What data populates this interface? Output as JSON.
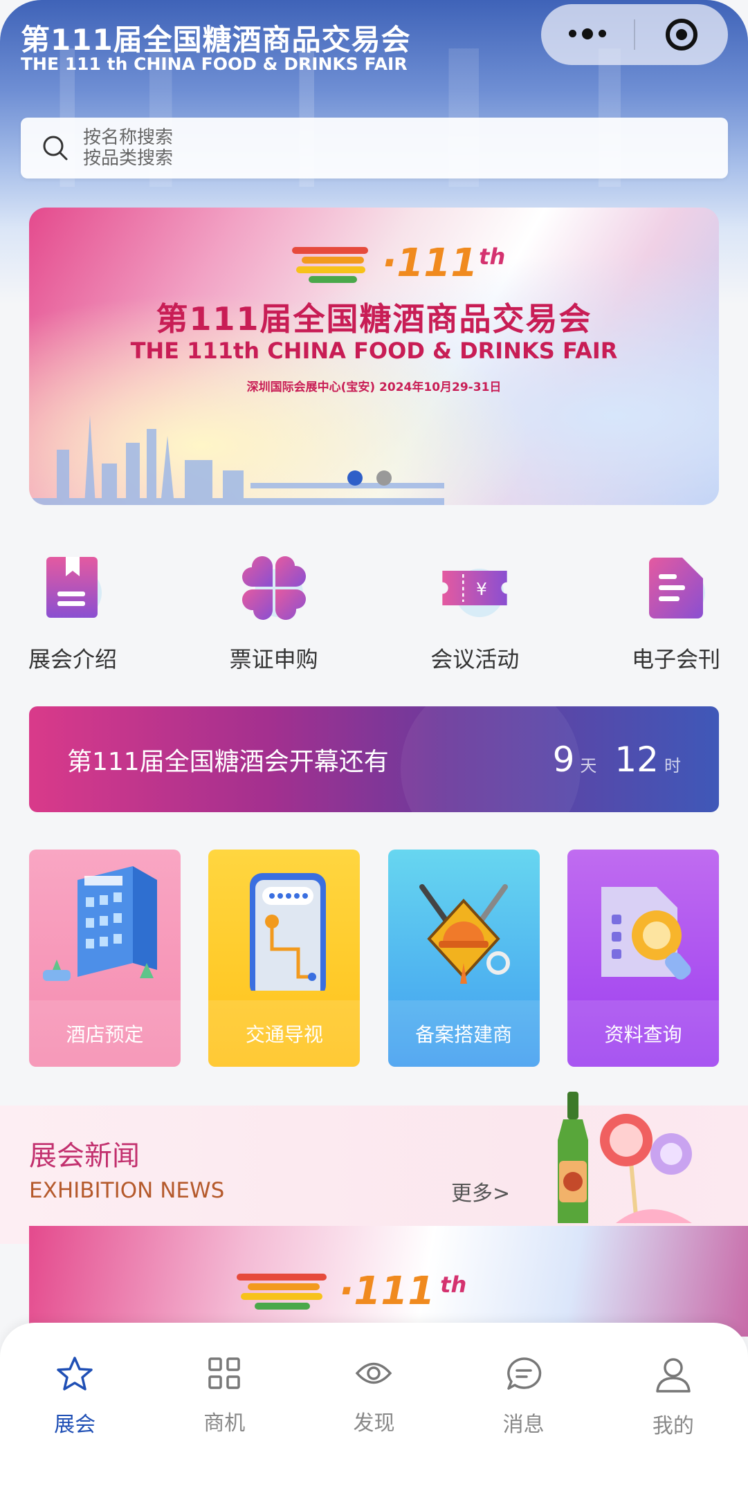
{
  "header": {
    "title_cn": "第111届全国糖酒商品交易会",
    "title_en": "THE 111 th CHINA FOOD & DRINKS FAIR"
  },
  "search": {
    "placeholder_line1": "按名称搜索",
    "placeholder_line2": "按品类搜索"
  },
  "banner": {
    "logo_number": "·111",
    "logo_suffix": "th",
    "title_cn": "第111届全国糖酒商品交易会",
    "title_en": "THE 111th CHINA FOOD & DRINKS FAIR",
    "venue": "深圳国际会展中心(宝安)    2024年10月29-31日",
    "slide_count": 2,
    "active_slide": 1
  },
  "quick_nav": [
    {
      "label": "展会介绍",
      "icon": "bookmark-document-icon"
    },
    {
      "label": "票证申购",
      "icon": "four-petal-icon"
    },
    {
      "label": "会议活动",
      "icon": "yuan-ticket-icon"
    },
    {
      "label": "电子会刊",
      "icon": "e-journal-icon"
    }
  ],
  "countdown": {
    "text": "第111届全国糖酒会开幕还有",
    "days": "9",
    "days_unit": "天",
    "hours": "12",
    "hours_unit": "时"
  },
  "services": [
    {
      "label": "酒店预定",
      "icon": "hotel-building-icon"
    },
    {
      "label": "交通导视",
      "icon": "phone-map-icon"
    },
    {
      "label": "备案搭建商",
      "icon": "construction-tools-icon"
    },
    {
      "label": "资料查询",
      "icon": "document-search-icon"
    }
  ],
  "news": {
    "title": "展会新闻",
    "subtitle": "EXHIBITION NEWS",
    "more": "更多>"
  },
  "tabbar": [
    {
      "label": "展会",
      "icon": "star-icon",
      "active": true
    },
    {
      "label": "商机",
      "icon": "grid-icon",
      "active": false
    },
    {
      "label": "发现",
      "icon": "eye-icon",
      "active": false
    },
    {
      "label": "消息",
      "icon": "message-icon",
      "active": false
    },
    {
      "label": "我的",
      "icon": "user-icon",
      "active": false
    }
  ],
  "colors": {
    "accent": "#1f4fb5",
    "brand_red": "#c81d55",
    "news_title": "#c2306e"
  }
}
